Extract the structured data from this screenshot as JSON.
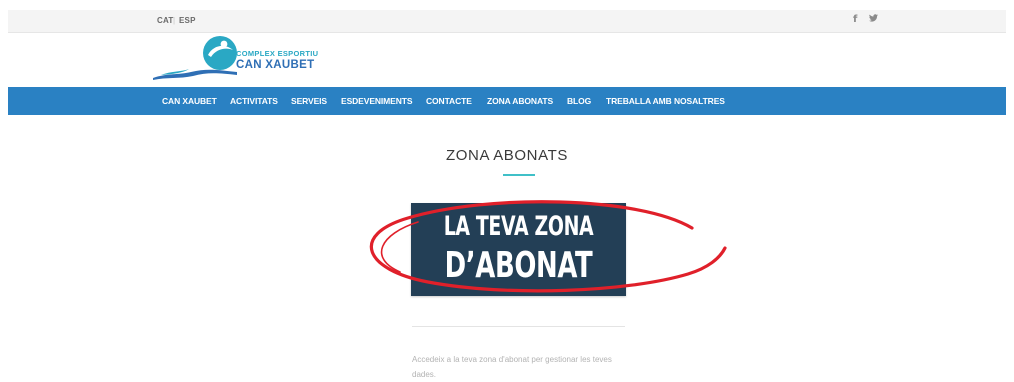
{
  "topbar": {
    "languages": [
      {
        "label": "CAT"
      },
      {
        "label": "ESP"
      }
    ],
    "language_separator": "|",
    "social": [
      {
        "icon": "facebook-icon",
        "glyph": "f"
      },
      {
        "icon": "twitter-icon",
        "glyph": "🐦"
      }
    ]
  },
  "logo": {
    "line1": "COMPLEX ESPORTIU",
    "line2": "CAN XAUBET",
    "colors": {
      "teal": "#2aa8c4",
      "blue": "#2f6fb5"
    }
  },
  "nav": {
    "background": "#2a81c3",
    "items": [
      {
        "label": "CAN XAUBET"
      },
      {
        "label": "ACTIVITATS"
      },
      {
        "label": "SERVEIS"
      },
      {
        "label": "ESDEVENIMENTS"
      },
      {
        "label": "CONTACTE"
      },
      {
        "label": "ZONA ABONATS"
      },
      {
        "label": "BLOG"
      },
      {
        "label": "TREBALLA AMB NOSALTRES"
      }
    ]
  },
  "main": {
    "page_title": "ZONA ABONATS",
    "accent_rule_color": "#40c0c8",
    "banner": {
      "line1": "LA TEVA ZONA",
      "line2": "D’ABONAT",
      "background": "#233f56"
    },
    "highlight_circle_color": "#e0202a",
    "description": "Accedeix a la teva zona d'abonat per gestionar les teves dades."
  }
}
